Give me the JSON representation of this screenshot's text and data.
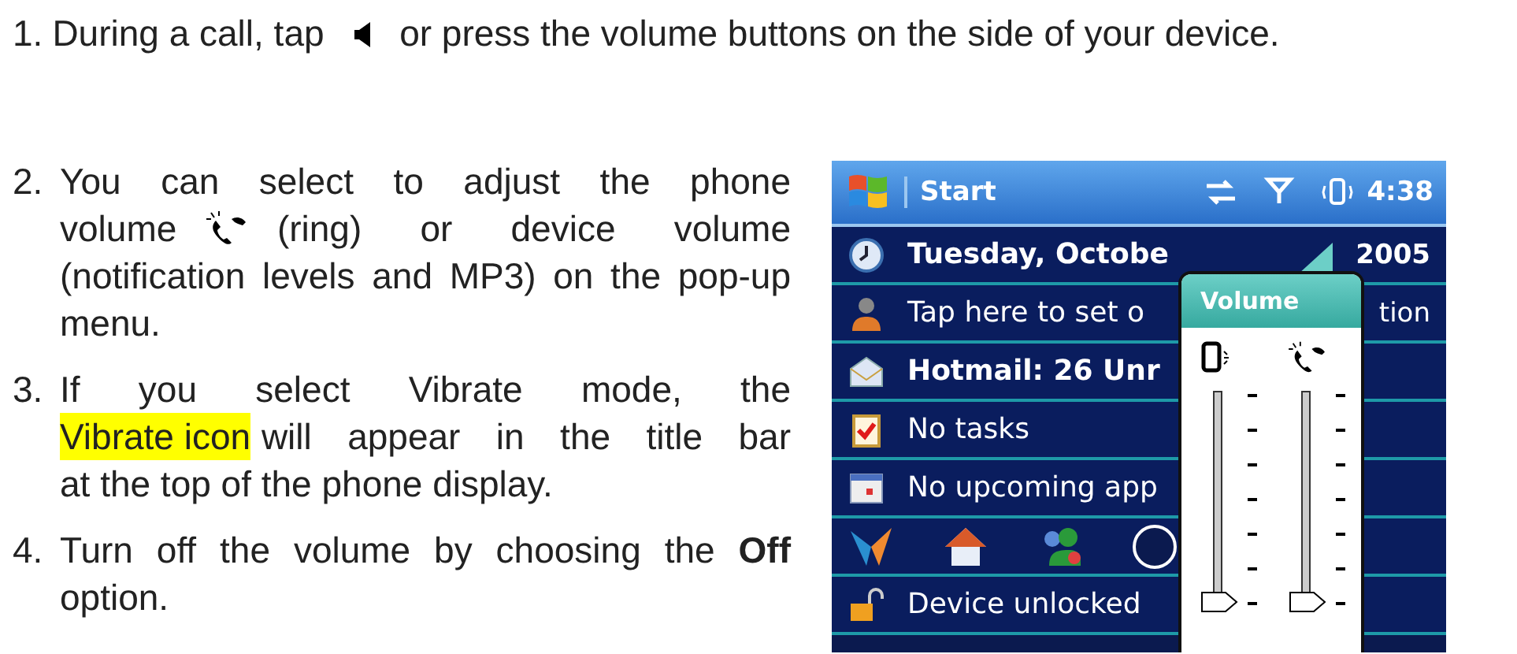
{
  "steps": [
    {
      "number": "1.",
      "lines": [
        [
          {
            "kind": "text",
            "text": "During a call, tap"
          },
          {
            "kind": "speaker-icon"
          },
          {
            "kind": "text",
            "text": "or press the volume buttons on the side of your device."
          }
        ]
      ]
    },
    {
      "number": "2.",
      "lines": [
        [
          {
            "kind": "text",
            "text": "You can select to adjust the phone"
          }
        ],
        [
          {
            "kind": "text",
            "text": "volume"
          },
          {
            "kind": "ring-icon"
          },
          {
            "kind": "text",
            "text": "(ring) or device volume"
          }
        ],
        [
          {
            "kind": "text",
            "text": "(notification levels and MP3) on the pop-up menu."
          }
        ]
      ]
    },
    {
      "number": "3.",
      "lines": [
        [
          {
            "kind": "text",
            "text": "If you select Vibrate mode, the"
          }
        ],
        [
          {
            "kind": "highlight",
            "text": "Vibrate icon"
          },
          {
            "kind": "text",
            "text": "will appear in the title bar"
          }
        ],
        [
          {
            "kind": "text",
            "text": "at the top of the phone display."
          }
        ]
      ]
    },
    {
      "number": "4.",
      "lines": [
        [
          {
            "kind": "text",
            "text": "Turn off the volume by choosing the **Off** option."
          }
        ]
      ]
    }
  ],
  "phone": {
    "title_bar": {
      "start": "Start",
      "time": "4:38"
    },
    "rows": [
      {
        "kind": "clock",
        "text": "Tuesday, Octobe",
        "tail": "2005",
        "bold": true
      },
      {
        "kind": "person",
        "text": "Tap here to set o",
        "tail": "tion",
        "bold": false
      },
      {
        "kind": "mail",
        "text": "Hotmail: 26 Unr",
        "bold": true
      },
      {
        "kind": "tasks",
        "text": "No tasks",
        "bold": false
      },
      {
        "kind": "calendar",
        "text": "No upcoming app",
        "bold": false
      },
      {
        "kind": "launcher"
      },
      {
        "kind": "lock",
        "text": "Device unlocked",
        "bold": false
      }
    ],
    "volume_popup": {
      "title": "Volume",
      "sliders": [
        {
          "kind": "device",
          "level": 0
        },
        {
          "kind": "ring",
          "level": 0
        }
      ]
    }
  }
}
